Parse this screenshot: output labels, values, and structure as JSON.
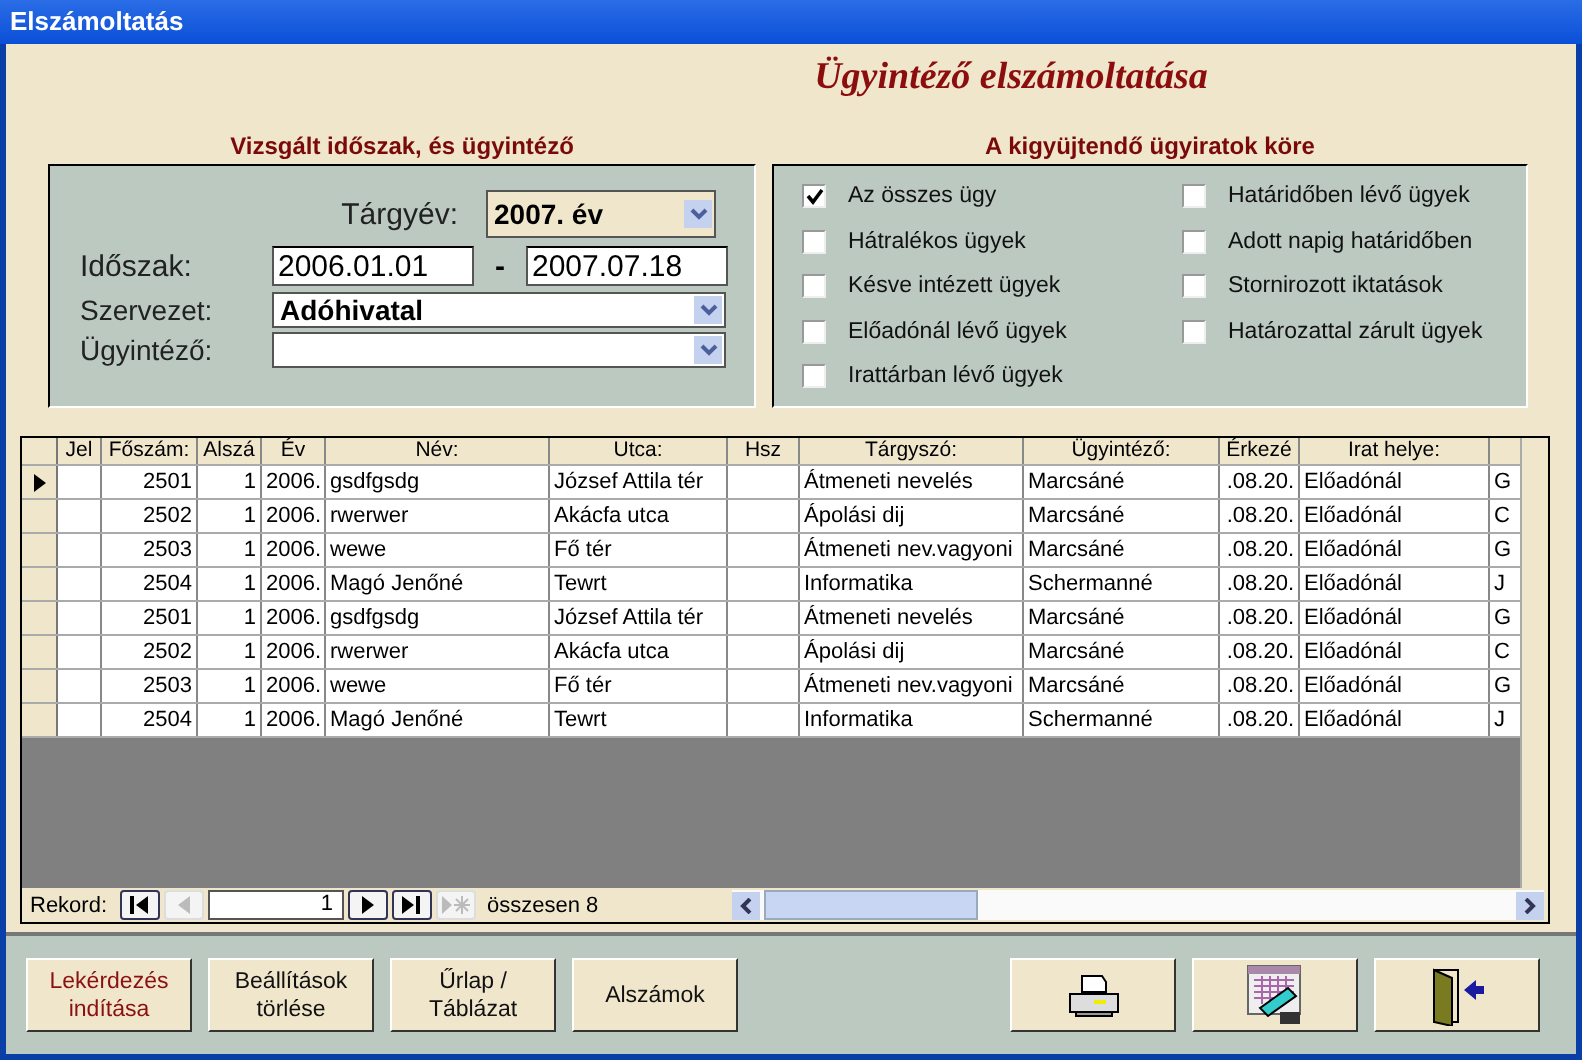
{
  "window": {
    "title": "Elszámoltatás"
  },
  "header": {
    "title": "Ügyintéző elszámoltatása"
  },
  "period_section": {
    "title": "Vizsgált időszak, és ügyintéző",
    "year": {
      "label": "Tárgyév:",
      "value": "2007. év"
    },
    "period": {
      "label": "Időszak:",
      "from": "2006.01.01",
      "separator": "-",
      "to": "2007.07.18"
    },
    "organization": {
      "label": "Szervezet:",
      "value": "Adóhivatal"
    },
    "clerk": {
      "label": "Ügyintéző:"
    }
  },
  "filter_section": {
    "title": "A kigyüjtendő ügyiratok köre",
    "options": [
      {
        "label": "Az összes ügy",
        "checked": true
      },
      {
        "label": "Hátralékos ügyek",
        "checked": false
      },
      {
        "label": "Késve intézett ügyek",
        "checked": false
      },
      {
        "label": "Előadónál lévő ügyek",
        "checked": false
      },
      {
        "label": "Irattárban lévő ügyek",
        "checked": false
      },
      {
        "label": "Határidőben lévő ügyek",
        "checked": false
      },
      {
        "label": "Adott napig határidőben",
        "checked": false
      },
      {
        "label": "Stornirozott iktatások",
        "checked": false
      },
      {
        "label": "Határozattal zárult ügyek",
        "checked": false
      }
    ]
  },
  "table": {
    "columns": [
      "Jel",
      "Főszám:",
      "Alszá",
      "Év",
      "Név:",
      "Utca:",
      "Hsz",
      "Tárgyszó:",
      "Ügyintéző:",
      "Érkezé",
      "Irat helye:"
    ],
    "rows": [
      {
        "current": true,
        "cells": [
          "",
          "2501",
          "1",
          "2006.",
          "gsdfgsdg",
          "József Attila tér",
          "",
          "Átmeneti nevelés",
          "Marcsáné",
          ".08.20.",
          "Előadónál",
          "G"
        ]
      },
      {
        "current": false,
        "cells": [
          "",
          "2502",
          "1",
          "2006.",
          "rwerwer",
          "Akácfa utca",
          "",
          "Ápolási dij",
          "Marcsáné",
          ".08.20.",
          "Előadónál",
          "C"
        ]
      },
      {
        "current": false,
        "cells": [
          "",
          "2503",
          "1",
          "2006.",
          "wewe",
          "Fő tér",
          "",
          "Átmeneti nev.vagyoni",
          "Marcsáné",
          ".08.20.",
          "Előadónál",
          "G"
        ]
      },
      {
        "current": false,
        "cells": [
          "",
          "2504",
          "1",
          "2006.",
          "Magó Jenőné",
          "Tewrt",
          "",
          "Informatika",
          "Schermanné",
          ".08.20.",
          "Előadónál",
          "J"
        ]
      },
      {
        "current": false,
        "cells": [
          "",
          "2501",
          "1",
          "2006.",
          "gsdfgsdg",
          "József Attila tér",
          "",
          "Átmeneti nevelés",
          "Marcsáné",
          ".08.20.",
          "Előadónál",
          "G"
        ]
      },
      {
        "current": false,
        "cells": [
          "",
          "2502",
          "1",
          "2006.",
          "rwerwer",
          "Akácfa utca",
          "",
          "Ápolási dij",
          "Marcsáné",
          ".08.20.",
          "Előadónál",
          "C"
        ]
      },
      {
        "current": false,
        "cells": [
          "",
          "2503",
          "1",
          "2006.",
          "wewe",
          "Fő tér",
          "",
          "Átmeneti nev.vagyoni",
          "Marcsáné",
          ".08.20.",
          "Előadónál",
          "G"
        ]
      },
      {
        "current": false,
        "cells": [
          "",
          "2504",
          "1",
          "2006.",
          "Magó Jenőné",
          "Tewrt",
          "",
          "Informatika",
          "Schermanné",
          ".08.20.",
          "Előadónál",
          "J"
        ]
      }
    ]
  },
  "navigator": {
    "label": "Rekord:",
    "record": "1",
    "total": "összesen  8"
  },
  "buttons": [
    {
      "kind": "text",
      "label": "Lekérdezés indítása",
      "highlight": true
    },
    {
      "kind": "text",
      "label": "Beállítások törlése",
      "highlight": false
    },
    {
      "kind": "text",
      "label": "Űrlap / Táblázat",
      "highlight": false
    },
    {
      "kind": "text",
      "label": "Alszámok",
      "highlight": false
    },
    {
      "kind": "printer"
    },
    {
      "kind": "report"
    },
    {
      "kind": "exit"
    }
  ]
}
